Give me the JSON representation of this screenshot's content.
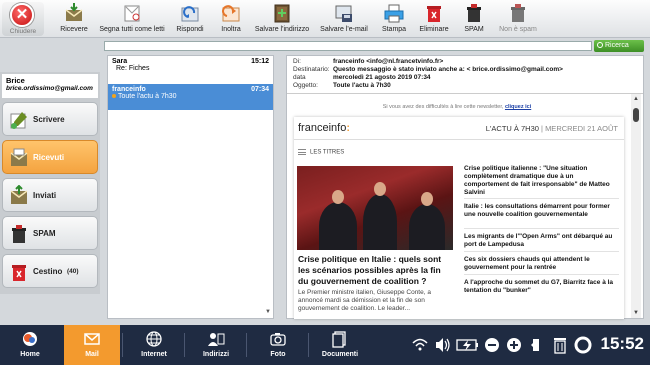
{
  "toolbar": {
    "close_label": "Chiudere",
    "items": [
      {
        "label": "Ricevere"
      },
      {
        "label": "Segna tutti come letti"
      },
      {
        "label": "Rispondi"
      },
      {
        "label": "Inoltra"
      },
      {
        "label": "Salvare l'indirizzo"
      },
      {
        "label": "Salvare l'e-mail"
      },
      {
        "label": "Stampa"
      },
      {
        "label": "Eliminare"
      },
      {
        "label": "SPAM"
      },
      {
        "label": "Non è spam"
      }
    ]
  },
  "search": {
    "value": "",
    "button_label": "Ricerca"
  },
  "account": {
    "name": "Brice",
    "email": "brice.ordissimo@gmail.com"
  },
  "folders": [
    {
      "label": "Scrivere"
    },
    {
      "label": "Ricevuti"
    },
    {
      "label": "Inviati"
    },
    {
      "label": "SPAM"
    },
    {
      "label": "Cestino",
      "count": "(40)"
    }
  ],
  "messages": [
    {
      "from": "Sara",
      "time": "15:12",
      "subject": "Re: Fiches"
    },
    {
      "from": "franceinfo",
      "time": "07:34",
      "subject": "Toute l'actu à 7h30"
    }
  ],
  "email": {
    "header": [
      {
        "key": "Di:",
        "value": "franceinfo <info@nl.francetvinfo.fr>"
      },
      {
        "key": "Destinatario:",
        "value": "Questo messaggio è stato inviato anche a: < brice.ordissimo@gmail.com>"
      },
      {
        "key": "data",
        "value": "mercoledì 21 agosto 2019 07:34"
      },
      {
        "key": "Oggetto:",
        "value": "Toute l'actu à 7h30"
      }
    ],
    "note": "Si vous avez des difficultés à lire cette newsletter,",
    "note_link": "cliquez ici",
    "logo": "franceinfo",
    "logo_colon": ":",
    "edition": "L'ACTU À 7H30",
    "edition_sep": "|",
    "edition_date": "MERCREDI 21 AOÛT",
    "section_title": "LES TITRES",
    "main_headline": "Crise politique en Italie : quels sont les scénarios possibles après la fin du gouvernement de coalition ?",
    "main_body": "Le Premier ministre italien, Giuseppe Conte, a annoncé mardi sa démission et la fin de son gouvernement de coalition. Le leader...",
    "side_headlines": [
      "Crise politique italienne : \"Une situation complètement dramatique due à un comportement de fait irresponsable\" de Matteo Salvini",
      "Italie : les consultations démarrent pour former une nouvelle coalition gouvernementale",
      "Les migrants de l'\"Open Arms\" ont débarqué au port de Lampedusa",
      "Ces six dossiers chauds qui attendent le gouvernement pour la rentrée",
      "A l'approche du sommet du G7, Biarritz face à la tentation du \"bunker\""
    ]
  },
  "taskbar": {
    "items": [
      {
        "label": "Home"
      },
      {
        "label": "Mail"
      },
      {
        "label": "Internet"
      },
      {
        "label": "Indirizzi"
      },
      {
        "label": "Foto"
      },
      {
        "label": "Documenti"
      }
    ],
    "clock": "15:52"
  }
}
